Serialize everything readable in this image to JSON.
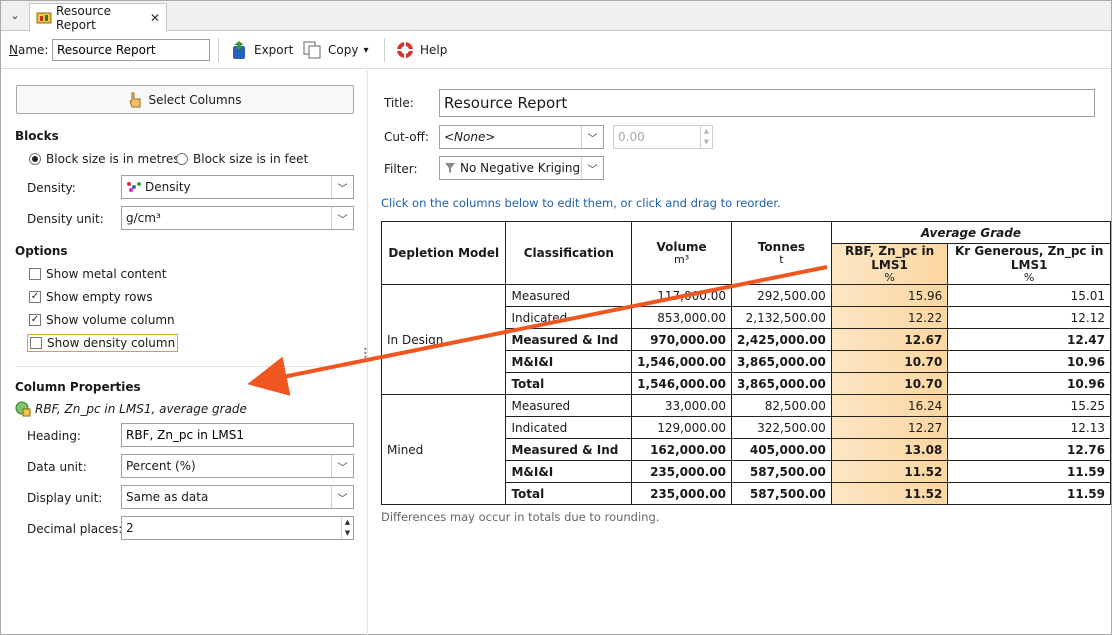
{
  "tab": {
    "title": "Resource Report",
    "close": "✕",
    "menu": "⌄"
  },
  "toolbar": {
    "name_label": "Name:",
    "name_value": "Resource Report",
    "export_label": "Export",
    "copy_label": "Copy",
    "help_label": "Help"
  },
  "left": {
    "select_columns": "Select Columns",
    "blocks_title": "Blocks",
    "radio_metres": "Block size is in metres",
    "radio_feet": "Block size is in feet",
    "density_label": "Density:",
    "density_value": "Density",
    "density_unit_label": "Density unit:",
    "density_unit_value": "g/cm³",
    "options_title": "Options",
    "opt_metal": "Show metal content",
    "opt_empty": "Show empty rows",
    "opt_volume": "Show volume column",
    "opt_density": "Show density column",
    "colprops_title": "Column Properties",
    "colprops_subtitle": "RBF, Zn_pc in LMS1, average grade",
    "heading_label": "Heading:",
    "heading_value": "RBF, Zn_pc in LMS1",
    "data_unit_label": "Data unit:",
    "data_unit_value": "Percent (%)",
    "display_unit_label": "Display unit:",
    "display_unit_value": "Same as data",
    "decimal_label": "Decimal places:",
    "decimal_value": "2"
  },
  "right": {
    "title_label": "Title:",
    "title_value": "Resource Report",
    "cutoff_label": "Cut-off:",
    "cutoff_value": "<None>",
    "cutoff_number": "0.00",
    "filter_label": "Filter:",
    "filter_value": "No Negative Kriging",
    "hint": "Click on the columns below to edit them, or click and drag to reorder.",
    "footnote": "Differences may occur in totals due to rounding."
  },
  "table": {
    "group_header": "Average Grade",
    "headers": {
      "depletion": "Depletion Model",
      "classification": "Classification",
      "volume": "Volume",
      "volume_unit": "m³",
      "tonnes": "Tonnes",
      "tonnes_unit": "t",
      "rbf": "RBF, Zn_pc in LMS1",
      "rbf_unit": "%",
      "kr": "Kr Generous, Zn_pc in LMS1",
      "kr_unit": "%"
    },
    "groups": [
      {
        "name": "In Design",
        "rows": [
          {
            "class": "Measured",
            "volume": "117,000.00",
            "tonnes": "292,500.00",
            "rbf": "15.96",
            "kr": "15.01",
            "bold": false
          },
          {
            "class": "Indicated",
            "volume": "853,000.00",
            "tonnes": "2,132,500.00",
            "rbf": "12.22",
            "kr": "12.12",
            "bold": false
          },
          {
            "class": "Measured & Ind",
            "volume": "970,000.00",
            "tonnes": "2,425,000.00",
            "rbf": "12.67",
            "kr": "12.47",
            "bold": true
          },
          {
            "class": "M&I&I",
            "volume": "1,546,000.00",
            "tonnes": "3,865,000.00",
            "rbf": "10.70",
            "kr": "10.96",
            "bold": true
          },
          {
            "class": "Total",
            "volume": "1,546,000.00",
            "tonnes": "3,865,000.00",
            "rbf": "10.70",
            "kr": "10.96",
            "bold": true
          }
        ]
      },
      {
        "name": "Mined",
        "rows": [
          {
            "class": "Measured",
            "volume": "33,000.00",
            "tonnes": "82,500.00",
            "rbf": "16.24",
            "kr": "15.25",
            "bold": false
          },
          {
            "class": "Indicated",
            "volume": "129,000.00",
            "tonnes": "322,500.00",
            "rbf": "12.27",
            "kr": "12.13",
            "bold": false
          },
          {
            "class": "Measured & Ind",
            "volume": "162,000.00",
            "tonnes": "405,000.00",
            "rbf": "13.08",
            "kr": "12.76",
            "bold": true
          },
          {
            "class": "M&I&I",
            "volume": "235,000.00",
            "tonnes": "587,500.00",
            "rbf": "11.52",
            "kr": "11.59",
            "bold": true
          },
          {
            "class": "Total",
            "volume": "235,000.00",
            "tonnes": "587,500.00",
            "rbf": "11.52",
            "kr": "11.59",
            "bold": true
          }
        ]
      }
    ]
  },
  "colors": {
    "accent_arrow": "#f0561f",
    "highlight": "#fbd6a1",
    "link": "#1b5fa8"
  }
}
